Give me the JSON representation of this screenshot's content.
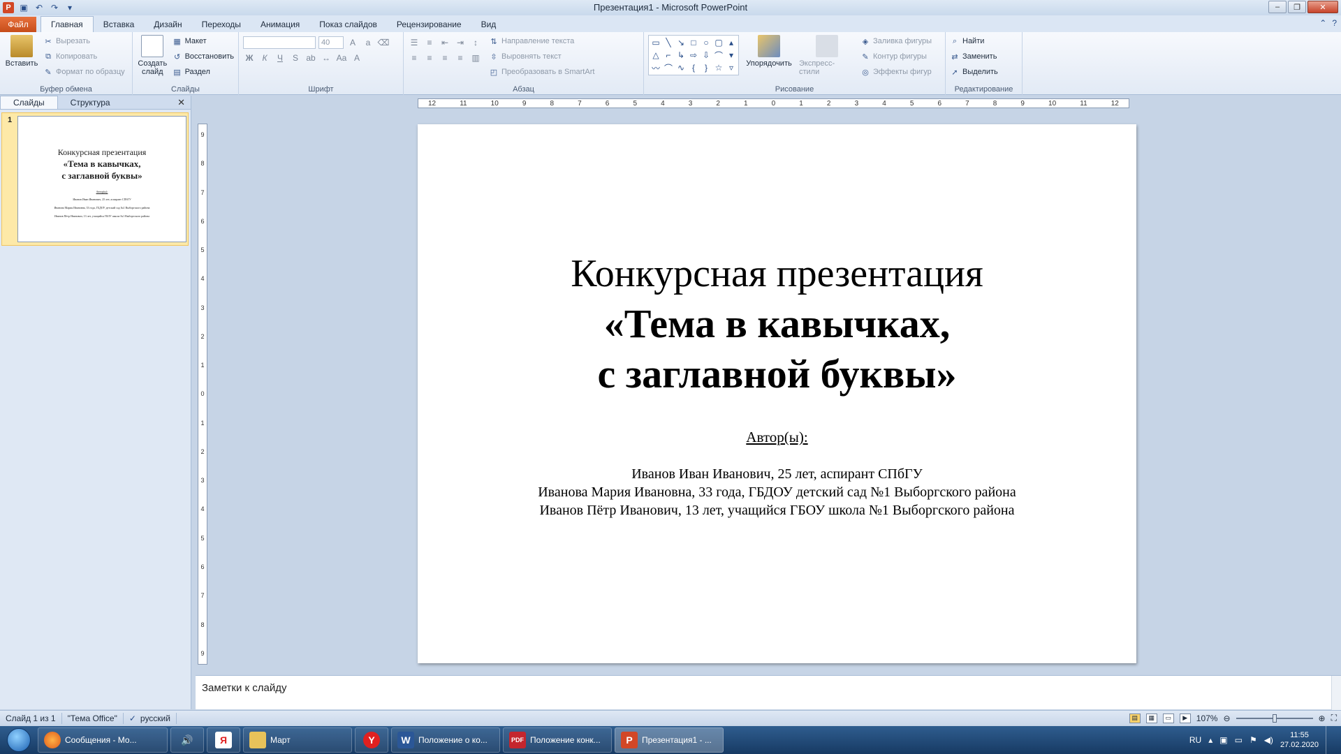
{
  "window": {
    "title": "Презентация1 - Microsoft PowerPoint"
  },
  "ribbon_tabs": {
    "file": "Файл",
    "tabs": [
      "Главная",
      "Вставка",
      "Дизайн",
      "Переходы",
      "Анимация",
      "Показ слайдов",
      "Рецензирование",
      "Вид"
    ],
    "active": "Главная"
  },
  "clipboard": {
    "paste": "Вставить",
    "cut": "Вырезать",
    "copy": "Копировать",
    "format_painter": "Формат по образцу",
    "group": "Буфер обмена"
  },
  "slides_group": {
    "new_slide": "Создать слайд",
    "layout": "Макет",
    "reset": "Восстановить",
    "section": "Раздел",
    "group": "Слайды"
  },
  "font_group": {
    "font_size": "40",
    "bold": "Ж",
    "italic": "К",
    "underline": "Ч",
    "strike": "S",
    "group": "Шрифт"
  },
  "paragraph_group": {
    "text_direction": "Направление текста",
    "align_text": "Выровнять текст",
    "smartart": "Преобразовать в SmartArt",
    "group": "Абзац"
  },
  "drawing_group": {
    "arrange": "Упорядочить",
    "quick_styles": "Экспресс-стили",
    "shape_fill": "Заливка фигуры",
    "shape_outline": "Контур фигуры",
    "shape_effects": "Эффекты фигур",
    "group": "Рисование"
  },
  "editing_group": {
    "find": "Найти",
    "replace": "Заменить",
    "select": "Выделить",
    "group": "Редактирование"
  },
  "left_pane": {
    "tab_slides": "Слайды",
    "tab_outline": "Структура",
    "slide_number": "1"
  },
  "ruler": {
    "h_ticks": [
      "12",
      "11",
      "10",
      "9",
      "8",
      "7",
      "6",
      "5",
      "4",
      "3",
      "2",
      "1",
      "0",
      "1",
      "2",
      "3",
      "4",
      "5",
      "6",
      "7",
      "8",
      "9",
      "10",
      "11",
      "12"
    ],
    "v_ticks": [
      "9",
      "8",
      "7",
      "6",
      "5",
      "4",
      "3",
      "2",
      "1",
      "0",
      "1",
      "2",
      "3",
      "4",
      "5",
      "6",
      "7",
      "8",
      "9"
    ]
  },
  "slide": {
    "title_line1": "Конкурсная презентация",
    "title_line2": "«Тема в кавычках,",
    "title_line3": "с заглавной буквы»",
    "author_label": "Автор(ы):",
    "author1": "Иванов Иван Иванович, 25 лет, аспирант СПбГУ",
    "author2": "Иванова Мария Ивановна, 33 года, ГБДОУ детский сад №1 Выборгского района",
    "author3": "Иванов Пётр Иванович, 13 лет, учащийся ГБОУ школа №1 Выборгского района"
  },
  "notes": {
    "placeholder": "Заметки к слайду"
  },
  "status": {
    "slide_info": "Слайд 1 из 1",
    "theme": "\"Тема Office\"",
    "language": "русский",
    "zoom": "107%"
  },
  "taskbar": {
    "items": [
      {
        "label": "Сообщения - Мо..."
      },
      {
        "label": "Март"
      },
      {
        "label": "Положение о ко..."
      },
      {
        "label": "Положение конк..."
      },
      {
        "label": "Презентация1 - ..."
      }
    ],
    "lang": "RU",
    "time": "11:55",
    "date": "27.02.2020"
  },
  "colors": {
    "accent_file_tab": "#d0501f",
    "ribbon_bg": "#e2eaf5",
    "taskbar": "#1f4a7a"
  }
}
